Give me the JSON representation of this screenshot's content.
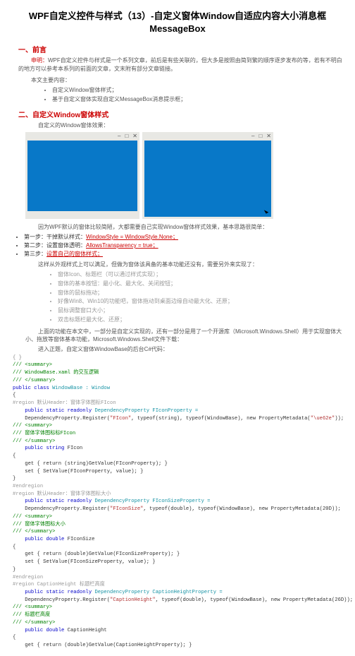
{
  "title": "WPF自定义控件与样式（13）-自定义窗体Window自适应内容大小消息框MessageBox",
  "sec1_heading": "一、前言",
  "intro_label": "申明：",
  "intro_text": "WPF自定义控件与样式是一个系列文章，前后是有些关联的，但大多是按照由简到繁的顺序逐步发布的等，若有不明白的地方可以参考本系列的前面的文章，文末附有部分文章链接。",
  "intro_sub": "本文主要内容：",
  "bullets1": [
    "自定义Window窗体样式；",
    "基于自定义窗体实现自定义MessageBox消息提示框；"
  ],
  "sec2_heading": "二、自定义Window窗体样式",
  "effect_label": "自定义的Window窗体效果：",
  "win1_title": "",
  "win2_title": "",
  "note1": "因为WPF默认的窗体比较简陋，大都需要自己实现Window窗体样式效果，基本思路很简单：",
  "steps": [
    {
      "pre": "第一步：干掉默认样式：",
      "lnk": "WindowStyle = WindowStyle.None；"
    },
    {
      "pre": "第二步：设置窗体透明：",
      "lnk": "AllowsTransparency = true；"
    },
    {
      "pre": "第三步：",
      "lnk": "设置自己的窗体样式；"
    }
  ],
  "note2": "这样从外观样式上可以满足，但做为窗体该具备的基本功能还没有，需要另外来实现了：",
  "bullets2": [
    "窗体Icon、标题栏（可以通过样式实现）；",
    "窗体的基本按钮：最小化、最大化、关闭按钮；",
    "窗体的鼠标拖动；",
    "好像Win8、Win10的功能吧，窗体拖动到桌面边缘自动最大化、还原；",
    "鼠标调整窗口大小；",
    "双击标题栏最大化、还原；"
  ],
  "note3": "上面的功能在本文中，一部分是自定义实现的，还有一部分是用了一个开源库（Microsoft.Windows.Shell）用于实现窗体大小、拖放等窗体基本功能，Microsoft.Windows.Shell文件下载：",
  "note4": "进入正题，自定义窗体WindowBase的后台C#代码：",
  "code": {
    "open_brace": "{ }",
    "summary0_a": "/// <summary>",
    "summary0_b": "/// WindowBase.xaml 的交互逻辑",
    "summary0_c": "/// </summary>",
    "class_decl_a": "public class ",
    "class_decl_b": "WindowBase : Window",
    "region1": "#region 默认Header：窗体字体图标FIcon",
    "dp1_a": "public static readonly ",
    "dp1_b": "DependencyProperty FIconProperty =",
    "dp1_c": "    DependencyProperty.Register(",
    "dp1_d": "\"FIcon\"",
    "dp1_e": ", typeof(string), typeof(WindowBase), new PropertyMetadata(",
    "dp1_f": "\"\\ue62e\"",
    "dp1_g": "));",
    "sum1_a": "/// <summary>",
    "sum1_b": "/// 窗体字体图标标FIcon",
    "sum1_c": "/// </summary>",
    "prop1_a": "public string ",
    "prop1_b": "FIcon",
    "prop1_c": "{",
    "prop1_d": "    get { return (string)GetValue(FIconProperty); }",
    "prop1_e": "    set { SetValue(FIconProperty, value); }",
    "prop1_f": "}",
    "endregion1": "#endregion",
    "region2": "#region 默认Header：窗体字体图标大小",
    "dp2_a": "public static readonly ",
    "dp2_b": "DependencyProperty FIconSizeProperty =",
    "dp2_c": "    DependencyProperty.Register(",
    "dp2_d": "\"FIconSize\"",
    "dp2_e": ", typeof(double), typeof(WindowBase), new PropertyMetadata(20D));",
    "sum2_a": "/// <summary>",
    "sum2_b": "/// 窗体字体图标大小",
    "sum2_c": "/// </summary>",
    "prop2_a": "public double ",
    "prop2_b": "FIconSize",
    "prop2_c": "{",
    "prop2_d": "    get { return (double)GetValue(FIconSizeProperty); }",
    "prop2_e": "    set { SetValue(FIconSizeProperty, value); }",
    "prop2_f": "}",
    "endregion2": "#endregion",
    "region3": "#region CaptionHeight 标题栏高度",
    "dp3_a": "public static readonly ",
    "dp3_b": "DependencyProperty CaptionHeightProperty =",
    "dp3_c": "    DependencyProperty.Register(",
    "dp3_d": "\"CaptionHeight\"",
    "dp3_e": ", typeof(double), typeof(WindowBase), new PropertyMetadata(26D));",
    "sum3_a": "/// <summary>",
    "sum3_b": "/// 标题栏高度",
    "sum3_c": "/// </summary>",
    "prop3_a": "public double ",
    "prop3_b": "CaptionHeight",
    "prop3_c": "{",
    "prop3_d": "    get { return (double)GetValue(CaptionHeightProperty); }"
  }
}
